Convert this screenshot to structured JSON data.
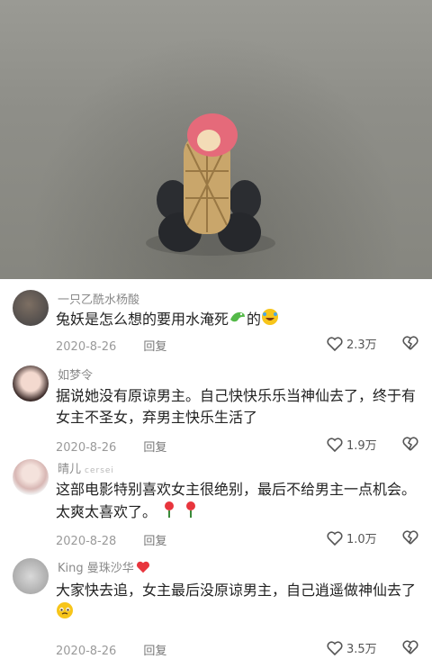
{
  "comments": [
    {
      "username": "一只乙酰水杨酸",
      "text": "兔妖是怎么想的要用水淹死",
      "text_suffix": "的",
      "date": "2020-8-26",
      "reply_label": "回复",
      "likes": "2.3万"
    },
    {
      "username": "如梦令",
      "text": "据说她没有原谅男主。自己快快乐乐当神仙去了，终于有女主不圣女，弃男主快乐生活了",
      "text_suffix": "",
      "date": "2020-8-26",
      "reply_label": "回复",
      "likes": "1.9万"
    },
    {
      "username": "晴儿",
      "username_note": "cersei",
      "text": "这部电影特别喜欢女主很绝别，最后不给男主一点机会。太爽太喜欢了。",
      "text_suffix": "",
      "date": "2020-8-28",
      "reply_label": "回复",
      "likes": "1.0万"
    },
    {
      "username": "King 曼珠沙华",
      "text": "大家快去追，女主最后没原谅男主，自己逍遥做神仙去了",
      "text_suffix": "",
      "date": "2020-8-26",
      "reply_label": "回复",
      "likes": "3.5万"
    }
  ],
  "colors": {
    "heart_red": "#e8353d",
    "text": "#222222",
    "meta": "#9a9a9a"
  }
}
